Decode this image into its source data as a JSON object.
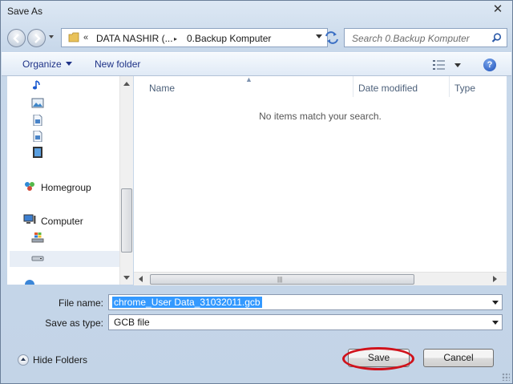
{
  "window": {
    "title": "Save As",
    "close_glyph": "✕"
  },
  "address": {
    "overflow_glyph": "«",
    "segments": [
      "DATA NASHIR (...",
      "0.Backup Komputer"
    ],
    "separator": "▸"
  },
  "search": {
    "placeholder": "Search 0.Backup Komputer"
  },
  "toolbar": {
    "organize_label": "Organize",
    "new_folder_label": "New folder",
    "help_glyph": "?"
  },
  "nav": {
    "items": [
      {
        "label": "",
        "icon": "music-note-icon"
      },
      {
        "label": "",
        "icon": "pictures-icon"
      },
      {
        "label": "",
        "icon": "document-icon"
      },
      {
        "label": "",
        "icon": "document-icon"
      },
      {
        "label": "",
        "icon": "video-icon"
      },
      {
        "label": "Homegroup",
        "icon": "homegroup-icon"
      },
      {
        "label": "Computer",
        "icon": "computer-icon"
      },
      {
        "label": "",
        "icon": "windows-drive-icon"
      },
      {
        "label": "",
        "icon": "drive-icon"
      }
    ]
  },
  "filelist": {
    "columns": [
      "Name",
      "Date modified",
      "Type"
    ],
    "empty_message": "No items match your search."
  },
  "form": {
    "filename_label": "File name:",
    "filename_value": "chrome_User Data_31032011.gcb",
    "savetype_label": "Save as type:",
    "savetype_value": "GCB file"
  },
  "footer": {
    "hide_folders_label": "Hide Folders",
    "save_label": "Save",
    "cancel_label": "Cancel"
  },
  "colors": {
    "highlight": "#3399ff",
    "annotation_ring": "#d0121b"
  }
}
